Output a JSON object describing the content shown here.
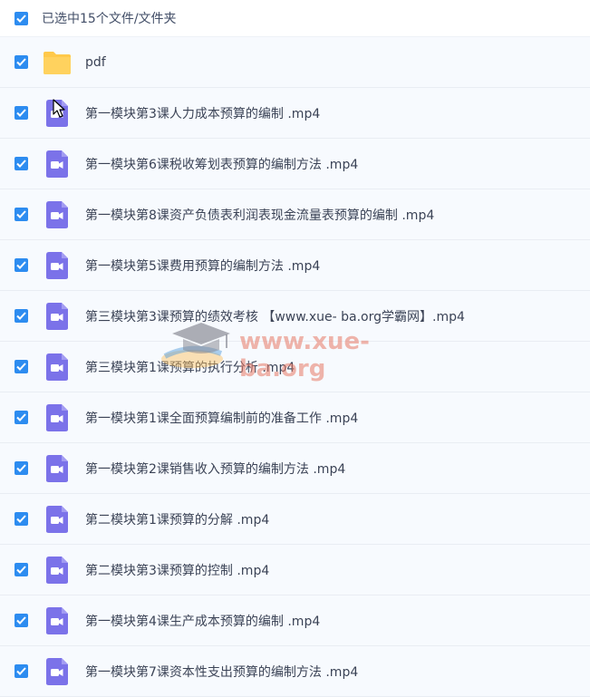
{
  "header": {
    "selected_text": "已选中15个文件/文件夹",
    "checked": true
  },
  "files": [
    {
      "name": "pdf",
      "type": "folder",
      "checked": true
    },
    {
      "name": "第一模块第3课人力成本预算的编制 .mp4",
      "type": "video",
      "checked": true
    },
    {
      "name": "第一模块第6课税收筹划表预算的编制方法 .mp4",
      "type": "video",
      "checked": true
    },
    {
      "name": "第一模块第8课资产负债表利润表现金流量表预算的编制 .mp4",
      "type": "video",
      "checked": true
    },
    {
      "name": "第一模块第5课费用预算的编制方法 .mp4",
      "type": "video",
      "checked": true
    },
    {
      "name": "第三模块第3课预算的绩效考核 【www.xue- ba.org学霸网】.mp4",
      "type": "video",
      "checked": true
    },
    {
      "name": "第三模块第1课预算的执行分析 .mp4",
      "type": "video",
      "checked": true
    },
    {
      "name": "第一模块第1课全面预算编制前的准备工作 .mp4",
      "type": "video",
      "checked": true
    },
    {
      "name": "第一模块第2课销售收入预算的编制方法 .mp4",
      "type": "video",
      "checked": true
    },
    {
      "name": "第二模块第1课预算的分解 .mp4",
      "type": "video",
      "checked": true
    },
    {
      "name": "第二模块第3课预算的控制 .mp4",
      "type": "video",
      "checked": true
    },
    {
      "name": "第一模块第4课生产成本预算的编制 .mp4",
      "type": "video",
      "checked": true
    },
    {
      "name": "第一模块第7课资本性支出预算的编制方法 .mp4",
      "type": "video",
      "checked": true
    }
  ],
  "watermark": {
    "text": "www.xue-ba.org"
  },
  "colors": {
    "checkbox": "#2d8cf0",
    "video_icon": "#7b72e9",
    "folder_icon": "#ffc94a",
    "row_bg": "#f7fafe"
  }
}
